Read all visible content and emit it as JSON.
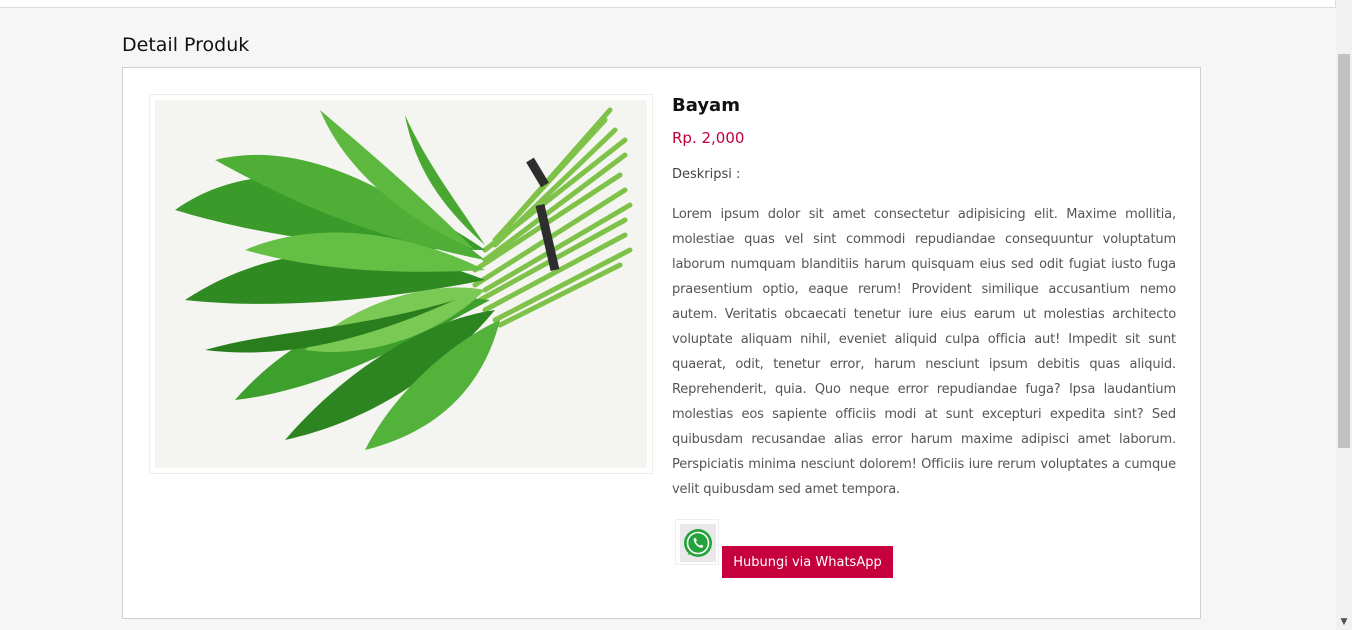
{
  "page": {
    "section_title": "Detail Produk"
  },
  "product": {
    "image_icon": "water-spinach-photo",
    "name": "Bayam",
    "price": "Rp. 2,000",
    "description_label": "Deskripsi :",
    "description": "Lorem ipsum dolor sit amet consectetur adipisicing elit. Maxime mollitia, molestiae quas vel sint commodi repudiandae consequuntur voluptatum laborum numquam blanditiis harum quisquam eius sed odit fugiat iusto fuga praesentium optio, eaque rerum! Provident similique accusantium nemo autem. Veritatis obcaecati tenetur iure eius earum ut molestias architecto voluptate aliquam nihil, eveniet aliquid culpa officia aut! Impedit sit sunt quaerat, odit, tenetur error, harum nesciunt ipsum debitis quas aliquid. Reprehenderit, quia. Quo neque error repudiandae fuga? Ipsa laudantium molestias eos sapiente officiis modi at sunt excepturi expedita sint? Sed quibusdam recusandae alias error harum maxime adipisci amet laborum. Perspiciatis minima nesciunt dolorem! Officiis iure rerum voluptates a cumque velit quibusdam sed amet tempora."
  },
  "contact": {
    "icon": "whatsapp-icon",
    "button_label": "Hubungi via WhatsApp"
  },
  "colors": {
    "accent": "#c6003d",
    "price": "#c0003a",
    "whatsapp_green": "#25a33b"
  }
}
